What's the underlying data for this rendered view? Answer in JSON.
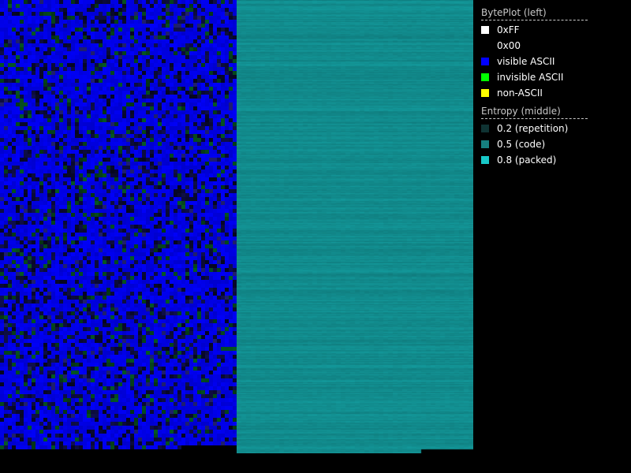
{
  "legend": {
    "byteplot_title": "BytePlot (left)",
    "byteplot_items": [
      {
        "label": "0xFF",
        "color": "#ffffff",
        "icon": "white-square"
      },
      {
        "label": "0x00",
        "color": "#000000",
        "icon": "black-square"
      },
      {
        "label": "visible ASCII",
        "color": "#0000ff",
        "icon": "blue-square"
      },
      {
        "label": "invisible ASCII",
        "color": "#00ff00",
        "icon": "green-square"
      },
      {
        "label": "non-ASCII",
        "color": "#ffff00",
        "icon": "yellow-square"
      }
    ],
    "entropy_title": "Entropy (middle)",
    "entropy_items": [
      {
        "label": "0.2 (repetition)",
        "color": "#0f3333",
        "icon": "dark-teal-square"
      },
      {
        "label": "0.5 (code)",
        "color": "#168080",
        "icon": "teal-square"
      },
      {
        "label": "0.8 (packed)",
        "color": "#18c8c8",
        "icon": "cyan-square"
      }
    ]
  },
  "colors": {
    "background": "#000000",
    "byteplot_visible_ascii": "#0000ee",
    "byteplot_dark": "#0a0a40",
    "byteplot_green": "#0a4a1a",
    "entropy_base": "#1aa8a8"
  }
}
